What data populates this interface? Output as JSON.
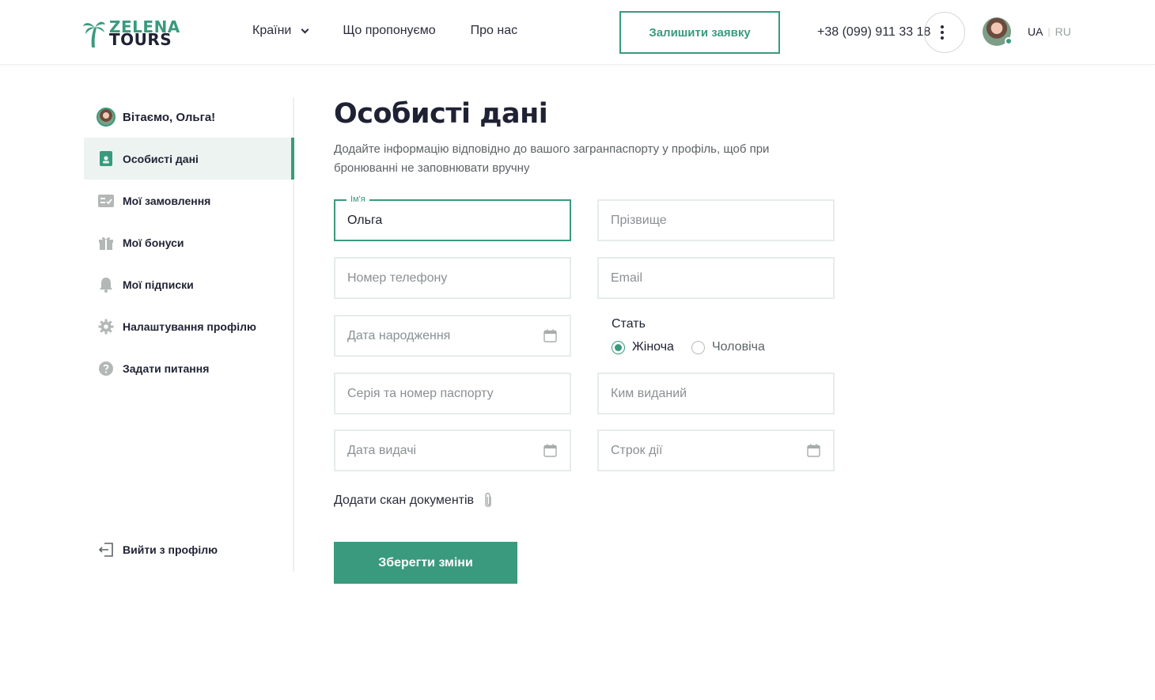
{
  "brand": {
    "line1": "ZELENA",
    "line2": "TOURS",
    "accent_color": "#3a9a7d"
  },
  "nav": {
    "countries": "Країни",
    "offers": "Що пропонуємо",
    "about": "Про нас"
  },
  "header": {
    "cta_label": "Залишити заявку",
    "phone": "+38 (099) 911 33 18",
    "lang_ua": "UA",
    "lang_sep": "|",
    "lang_ru": "RU"
  },
  "sidebar": {
    "greeting": "Вітаємо, Ольга!",
    "items": [
      {
        "label": "Особисті дані",
        "icon": "profile-card-icon",
        "active": true
      },
      {
        "label": "Мої замовлення",
        "icon": "orders-icon",
        "active": false
      },
      {
        "label": "Мої бонуси",
        "icon": "gift-icon",
        "active": false
      },
      {
        "label": "Мої підписки",
        "icon": "bell-icon",
        "active": false
      },
      {
        "label": "Налаштування профілю",
        "icon": "gear-icon",
        "active": false
      },
      {
        "label": "Задати питання",
        "icon": "question-icon",
        "active": false
      }
    ],
    "logout": "Вийти з профілю"
  },
  "main": {
    "title": "Особисті дані",
    "subtitle": "Додайте інформацію відповідно до вашого загранпаспорту у профіль, щоб при бронюванні не заповнювати вручну",
    "first_name": {
      "legend": "Ім'я",
      "value": "Ольга"
    },
    "last_name_placeholder": "Прізвище",
    "phone_placeholder": "Номер телефону",
    "email_placeholder": "Email",
    "birth_date_placeholder": "Дата народження",
    "gender": {
      "label": "Стать",
      "female": "Жіноча",
      "male": "Чоловіча",
      "selected": "female"
    },
    "passport_placeholder": "Серія та номер паспорту",
    "issued_by_placeholder": "Ким виданий",
    "issue_date_placeholder": "Дата видачі",
    "expiry_placeholder": "Строк дії",
    "attach_label": "Додати скан документів",
    "save_label": "Зберегти зміни"
  }
}
